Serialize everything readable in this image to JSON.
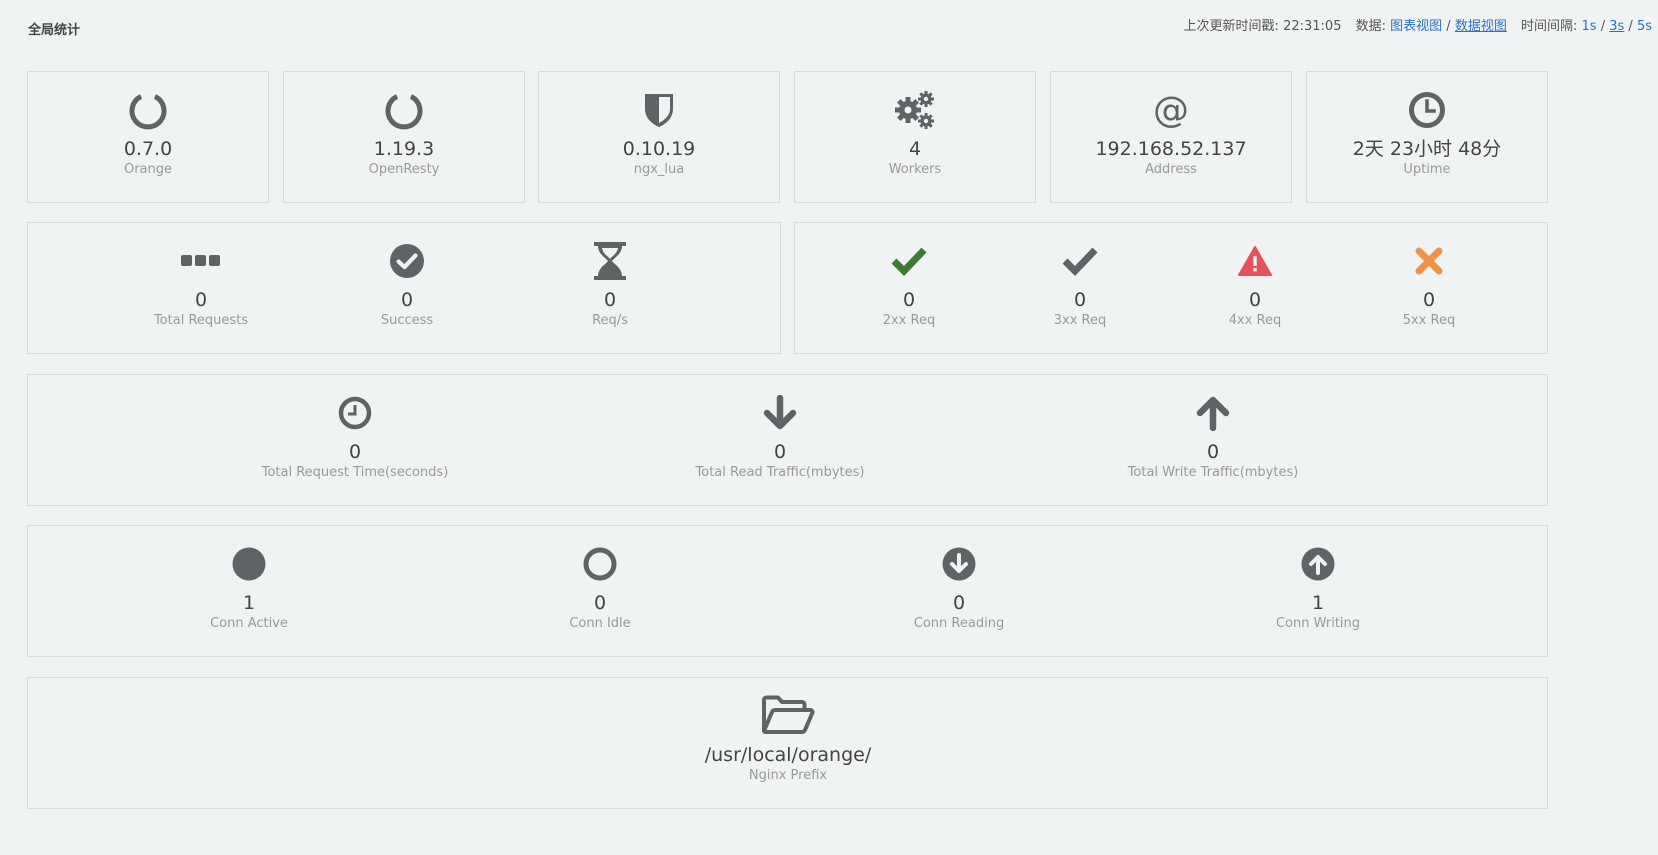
{
  "header": {
    "title": "全局统计",
    "update_label": "上次更新时间戳:",
    "update_time": "22:31:05",
    "data_label": "数据:",
    "chart_view": "图表视图",
    "data_view": "数据视图",
    "interval_label": "时间间隔:",
    "interval_1s": "1s",
    "interval_3s": "3s",
    "interval_5s": "5s",
    "slash": "/"
  },
  "info": {
    "orange": {
      "value": "0.7.0",
      "label": "Orange"
    },
    "openresty": {
      "value": "1.19.3",
      "label": "OpenResty"
    },
    "ngx_lua": {
      "value": "0.10.19",
      "label": "ngx_lua"
    },
    "workers": {
      "value": "4",
      "label": "Workers"
    },
    "address": {
      "value": "192.168.52.137",
      "label": "Address"
    },
    "uptime": {
      "value": "2天 23小时 48分",
      "label": "Uptime"
    }
  },
  "requests": {
    "total": {
      "value": "0",
      "label": "Total Requests"
    },
    "success": {
      "value": "0",
      "label": "Success"
    },
    "rps": {
      "value": "0",
      "label": "Req/s"
    }
  },
  "status_codes": {
    "s2xx": {
      "value": "0",
      "label": "2xx Req"
    },
    "s3xx": {
      "value": "0",
      "label": "3xx Req"
    },
    "s4xx": {
      "value": "0",
      "label": "4xx Req"
    },
    "s5xx": {
      "value": "0",
      "label": "5xx Req"
    }
  },
  "traffic": {
    "request_time": {
      "value": "0",
      "label": "Total Request Time(seconds)"
    },
    "read": {
      "value": "0",
      "label": "Total Read Traffic(mbytes)"
    },
    "write": {
      "value": "0",
      "label": "Total Write Traffic(mbytes)"
    }
  },
  "connections": {
    "active": {
      "value": "1",
      "label": "Conn Active"
    },
    "idle": {
      "value": "0",
      "label": "Conn Idle"
    },
    "reading": {
      "value": "0",
      "label": "Conn Reading"
    },
    "writing": {
      "value": "1",
      "label": "Conn Writing"
    }
  },
  "prefix": {
    "value": "/usr/local/orange/",
    "label": "Nginx Prefix"
  },
  "colors": {
    "icon": "#5f6366",
    "ok": "#3a7d32",
    "warn": "#e8505b",
    "error": "#f0924a",
    "link": "#2a73c3"
  }
}
